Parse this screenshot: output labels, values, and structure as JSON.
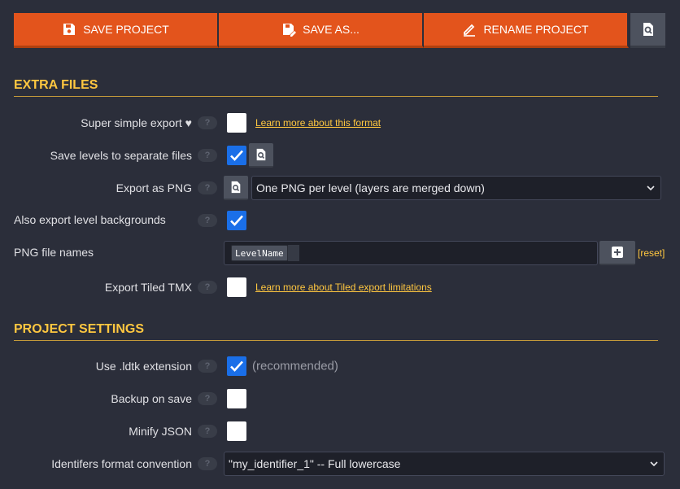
{
  "toolbar": {
    "save_label": "SAVE PROJECT",
    "save_as_label": "SAVE AS...",
    "rename_label": "RENAME PROJECT"
  },
  "sections": {
    "extra_files": "EXTRA FILES",
    "project_settings": "PROJECT SETTINGS"
  },
  "extra_files": {
    "super_simple": {
      "label": "Super simple export ♥",
      "checked": false,
      "link": "Learn more about this format"
    },
    "separate_files": {
      "label": "Save levels to separate files",
      "checked": true
    },
    "export_png": {
      "label": "Export as PNG",
      "selected": "One PNG per level (layers are merged down)"
    },
    "level_backgrounds": {
      "label": "Also export level backgrounds",
      "checked": true
    },
    "png_names": {
      "label": "PNG file names",
      "tag": "LevelName",
      "reset": "[reset]"
    },
    "tiled": {
      "label": "Export Tiled TMX",
      "checked": false,
      "link": "Learn more about Tiled export limitations"
    }
  },
  "project_settings": {
    "ldtk_ext": {
      "label": "Use .ldtk extension",
      "checked": true,
      "note": "(recommended)"
    },
    "backup": {
      "label": "Backup on save",
      "checked": false
    },
    "minify": {
      "label": "Minify JSON",
      "checked": false
    },
    "identifiers": {
      "label": "Identifers format convention",
      "selected": "\"my_identifier_1\" -- Full lowercase"
    }
  },
  "help_text": "?",
  "colors": {
    "accent": "#e3541c",
    "section": "#ffc740",
    "checkbox": "#1a6fe8",
    "background": "#2b2e3a"
  }
}
